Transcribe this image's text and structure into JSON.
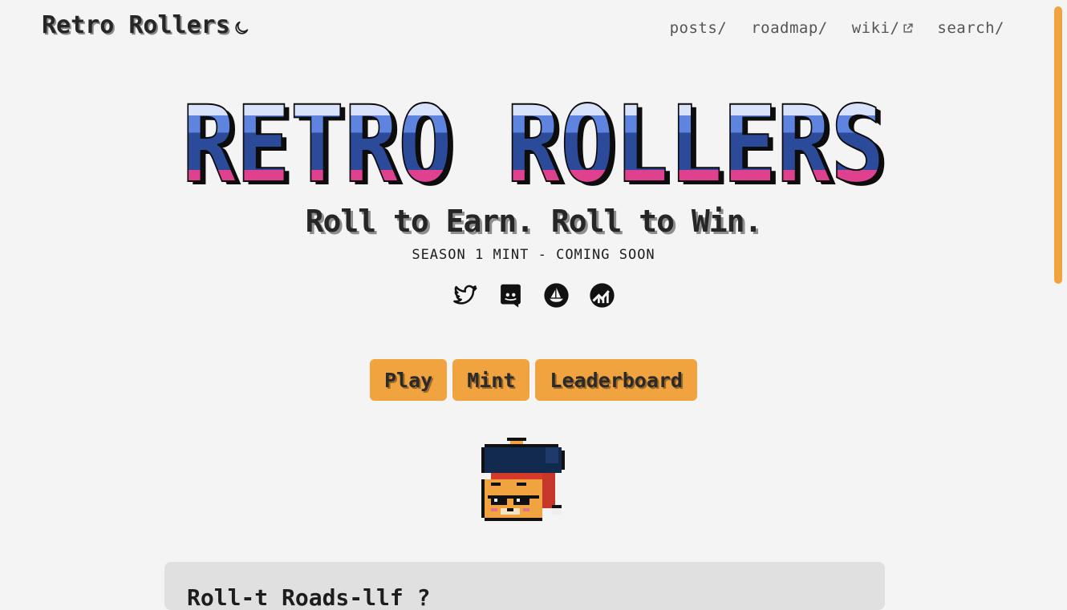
{
  "header": {
    "brand": "Retro Rollers",
    "theme_icon": "moon-icon",
    "nav": [
      {
        "label": "posts/",
        "icon": null
      },
      {
        "label": "roadmap/",
        "icon": null
      },
      {
        "label": "wiki/",
        "icon": "external-link-icon"
      },
      {
        "label": "search/",
        "icon": null
      }
    ]
  },
  "hero": {
    "title_art": "RETRO ROLLERS",
    "tagline": "Roll to Earn. Roll to Win.",
    "subtitle": "SEASON 1 MINT - COMING SOON",
    "socials": [
      "twitter-icon",
      "discord-icon",
      "opensea-icon",
      "dextools-icon"
    ],
    "colors": {
      "band_light": "#9db4f2",
      "band_pale": "#d8e2fb",
      "band_mid": "#5e84e0",
      "band_dark": "#2b4a9a",
      "band_pink": "#e0418e",
      "band_hot": "#ff5dbb",
      "outline": "#0d0d0d"
    }
  },
  "actions": {
    "play": "Play",
    "mint": "Mint",
    "leaderboard": "Leaderboard",
    "accent": "#f0a33e"
  },
  "card": {
    "title": "Roll-t Roads-llf ?"
  }
}
